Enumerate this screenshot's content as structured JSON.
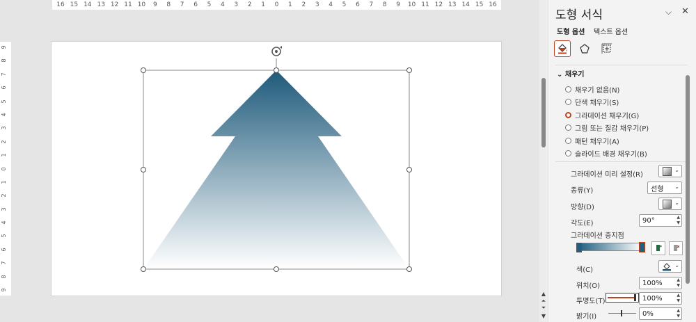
{
  "ruler": {
    "horizontal": [
      "16",
      "15",
      "14",
      "13",
      "12",
      "11",
      "10",
      "9",
      "8",
      "7",
      "6",
      "5",
      "4",
      "3",
      "2",
      "1",
      "0",
      "1",
      "2",
      "3",
      "4",
      "5",
      "6",
      "7",
      "8",
      "9",
      "10",
      "11",
      "12",
      "13",
      "14",
      "15",
      "16"
    ],
    "vertical": [
      "9",
      "8",
      "7",
      "6",
      "5",
      "4",
      "3",
      "2",
      "1",
      "0",
      "1",
      "2",
      "3",
      "4",
      "5",
      "6",
      "7",
      "8",
      "9"
    ]
  },
  "colors": {
    "accent": "#c04320",
    "shape_top": "#1e5a7b",
    "shape_bottom": "#ffffff"
  },
  "pane": {
    "title": "도형 서식",
    "tabs": {
      "shape_options": "도형 옵션",
      "text_options": "텍스트 옵션"
    },
    "icons": {
      "fill": "paint-bucket-icon",
      "effects": "pentagon-icon",
      "size": "size-position-icon"
    },
    "fill_section": "채우기",
    "fill_options": [
      {
        "label": "채우기 없음(N)",
        "selected": false
      },
      {
        "label": "단색 채우기(S)",
        "selected": false
      },
      {
        "label": "그라데이션 채우기(G)",
        "selected": true
      },
      {
        "label": "그림 또는 질감 채우기(P)",
        "selected": false
      },
      {
        "label": "패턴 채우기(A)",
        "selected": false
      },
      {
        "label": "슬라이드 배경 채우기(B)",
        "selected": false
      }
    ],
    "preset_label": "그라데이션 미리 설정(R)",
    "type_label": "종류(Y)",
    "type_value": "선형",
    "direction_label": "방향(D)",
    "angle_label": "각도(E)",
    "angle_value": "90°",
    "stops_label": "그라데이션 중지점",
    "color_label": "색(C)",
    "position_label": "위치(O)",
    "position_value": "100%",
    "transparency_label": "투명도(T)",
    "transparency_value": "100%",
    "brightness_label": "밝기(I)",
    "brightness_value": "0%"
  }
}
